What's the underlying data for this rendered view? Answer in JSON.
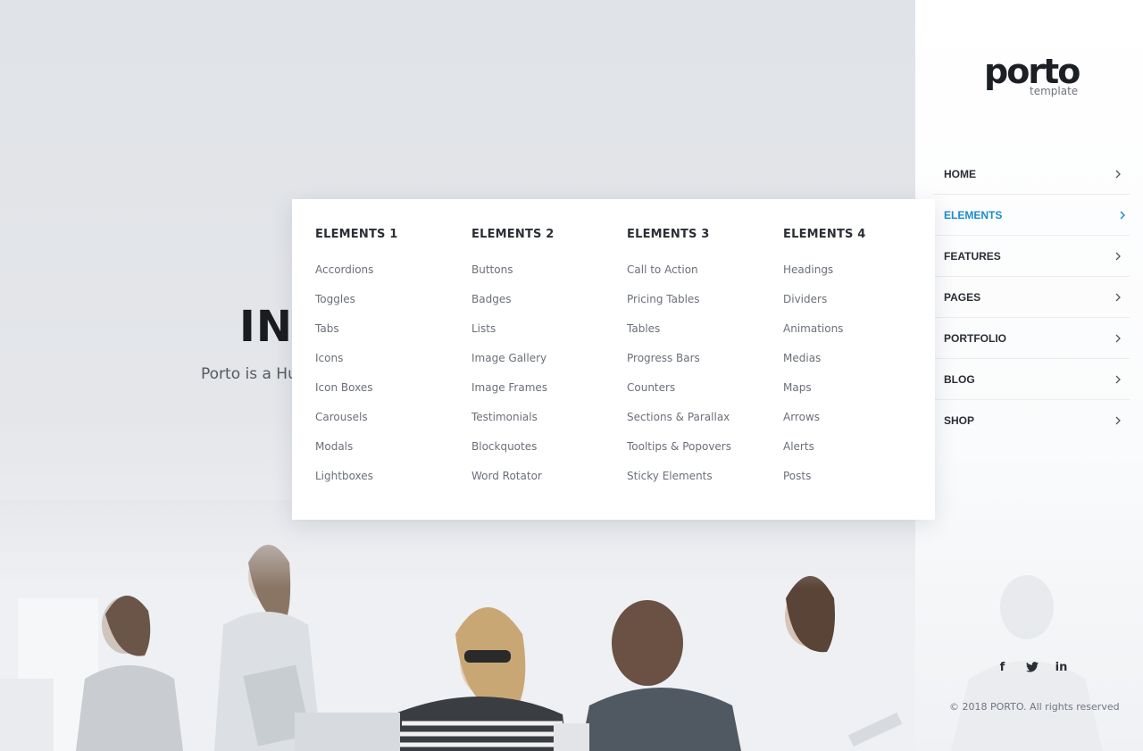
{
  "hero": {
    "heading": "IN",
    "subheading": "Porto is a Hu"
  },
  "sidebar": {
    "logo": {
      "word": "porto",
      "sub": "template"
    },
    "nav": [
      {
        "label": "HOME",
        "active": false
      },
      {
        "label": "ELEMENTS",
        "active": true
      },
      {
        "label": "FEATURES",
        "active": false
      },
      {
        "label": "PAGES",
        "active": false
      },
      {
        "label": "PORTFOLIO",
        "active": false
      },
      {
        "label": "BLOG",
        "active": false
      },
      {
        "label": "SHOP",
        "active": false
      }
    ],
    "social": [
      {
        "icon": "facebook-icon",
        "glyph": "f"
      },
      {
        "icon": "twitter-icon",
        "glyph": ""
      },
      {
        "icon": "linkedin-icon",
        "glyph": "in"
      }
    ],
    "copyright": "© 2018 PORTO. All rights reserved"
  },
  "mega_menu": {
    "columns": [
      {
        "title": "ELEMENTS 1",
        "links": [
          "Accordions",
          "Toggles",
          "Tabs",
          "Icons",
          "Icon Boxes",
          "Carousels",
          "Modals",
          "Lightboxes"
        ]
      },
      {
        "title": "ELEMENTS 2",
        "links": [
          "Buttons",
          "Badges",
          "Lists",
          "Image Gallery",
          "Image Frames",
          "Testimonials",
          "Blockquotes",
          "Word Rotator"
        ]
      },
      {
        "title": "ELEMENTS 3",
        "links": [
          "Call to Action",
          "Pricing Tables",
          "Tables",
          "Progress Bars",
          "Counters",
          "Sections & Parallax",
          "Tooltips & Popovers",
          "Sticky Elements"
        ]
      },
      {
        "title": "ELEMENTS 4",
        "links": [
          "Headings",
          "Dividers",
          "Animations",
          "Medias",
          "Maps",
          "Arrows",
          "Alerts",
          "Posts"
        ]
      }
    ]
  },
  "colors": {
    "accent": "#1a8ccf",
    "text_dark": "#2b2f35",
    "text_muted": "#6b7078"
  }
}
